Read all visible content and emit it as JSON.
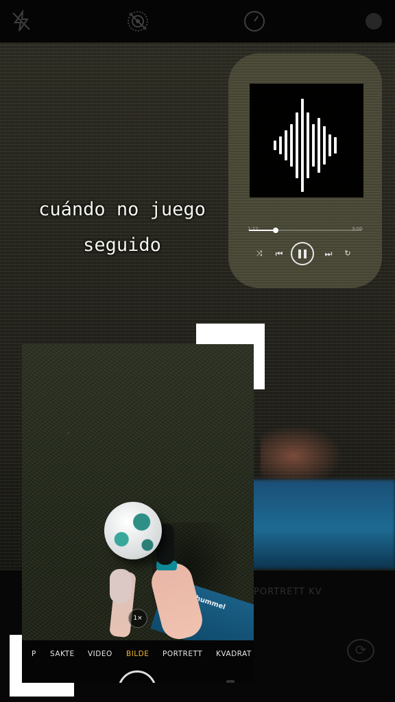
{
  "caption": {
    "line1": "cuándo no juego",
    "line2": "seguido"
  },
  "top_bar": {
    "icons": [
      "flash-off-icon",
      "live-photo-icon",
      "timer-icon",
      "camera-switch-icon"
    ]
  },
  "music_widget": {
    "artwork_icon": "soundwave-icon",
    "elapsed": "1:22",
    "remaining": "3:00",
    "progress": 0.24,
    "controls": [
      "shuffle-icon",
      "previous-icon",
      "pause-icon",
      "next-icon",
      "repeat-icon"
    ]
  },
  "camera": {
    "zoom_label": "1×",
    "modes": [
      {
        "label": "P",
        "active": false
      },
      {
        "label": "SAKTE",
        "active": false
      },
      {
        "label": "VIDEO",
        "active": false
      },
      {
        "label": "BILDE",
        "active": true
      },
      {
        "label": "PORTRETT",
        "active": false
      },
      {
        "label": "KVADRAT",
        "active": false
      }
    ],
    "active_color": "#f2b730",
    "shorts_brand": "hummel"
  },
  "background_camera": {
    "ghost_modes": "PORTRETT    KV"
  }
}
